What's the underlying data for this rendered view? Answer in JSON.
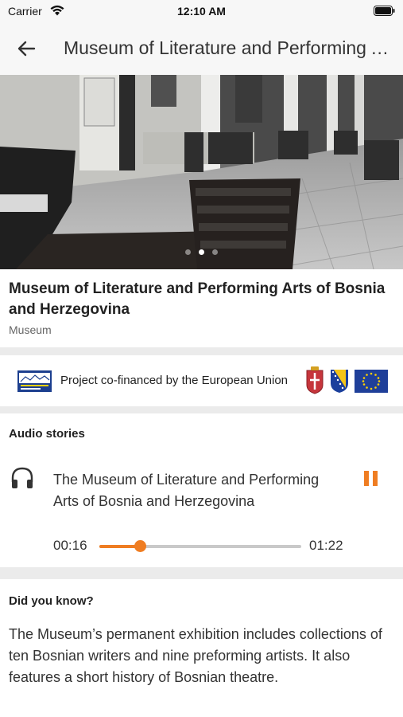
{
  "status_bar": {
    "carrier": "Carrier",
    "time": "12:10 AM"
  },
  "header": {
    "title": "Museum of Literature and Performing Arts of Bosnia and Herzegovina",
    "back_icon": "arrow-left-icon"
  },
  "hero": {
    "pager_dots": 3,
    "active_dot": 2
  },
  "place": {
    "title": "Museum of Literature and Performing Arts of Bosnia and Herzegovina",
    "category": "Museum"
  },
  "funding": {
    "text": "Project co-financed by the European Union"
  },
  "audio": {
    "heading": "Audio stories",
    "track_title": "The Museum of Literature and Performing Arts of Bosnia and Herzegovina",
    "current_time": "00:16",
    "total_time": "01:22",
    "progress": 0.2,
    "state": "playing",
    "icon": "headphones-icon"
  },
  "fact": {
    "heading": "Did you know?",
    "text": "The Museum’s permanent exhibition includes collections of ten Bosnian writers and nine preforming artists. It also features a short history of Bosnian theatre."
  },
  "colors": {
    "accent": "#ef7d22",
    "separator": "#ebebeb",
    "header_bg": "#f7f7f7"
  }
}
